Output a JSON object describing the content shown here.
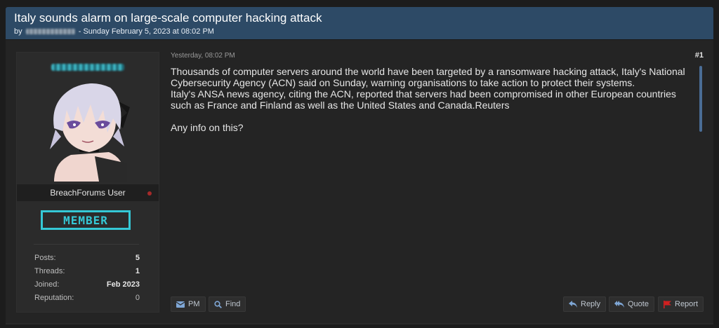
{
  "thread": {
    "title": "Italy sounds alarm on large-scale computer hacking attack",
    "meta_prefix": "by",
    "meta_suffix": "- Sunday February 5, 2023 at 08:02 PM"
  },
  "author": {
    "user_title": "BreachForums User",
    "rank": "MEMBER",
    "stats": [
      {
        "label": "Posts:",
        "value": "5"
      },
      {
        "label": "Threads:",
        "value": "1"
      },
      {
        "label": "Joined:",
        "value": "Feb 2023"
      },
      {
        "label": "Reputation:",
        "value": "0"
      }
    ]
  },
  "post": {
    "date": "Yesterday, 08:02 PM",
    "number": "#1",
    "lines": [
      "Thousands of computer servers around the world have been targeted by a ransomware hacking attack, Italy's National Cybersecurity Agency (ACN) said on Sunday, warning organisations to take action to protect their systems.",
      "Italy's ANSA news agency, citing the ACN, reported that servers had been compromised in other European countries such as France and Finland as well as the United States and Canada.Reuters",
      "Any info on this?"
    ]
  },
  "buttons": {
    "pm": "PM",
    "find": "Find",
    "reply": "Reply",
    "quote": "Quote",
    "report": "Report"
  },
  "colors": {
    "header": "#2d4a66",
    "rank": "#35c8d6",
    "report_flag": "#d02020"
  }
}
